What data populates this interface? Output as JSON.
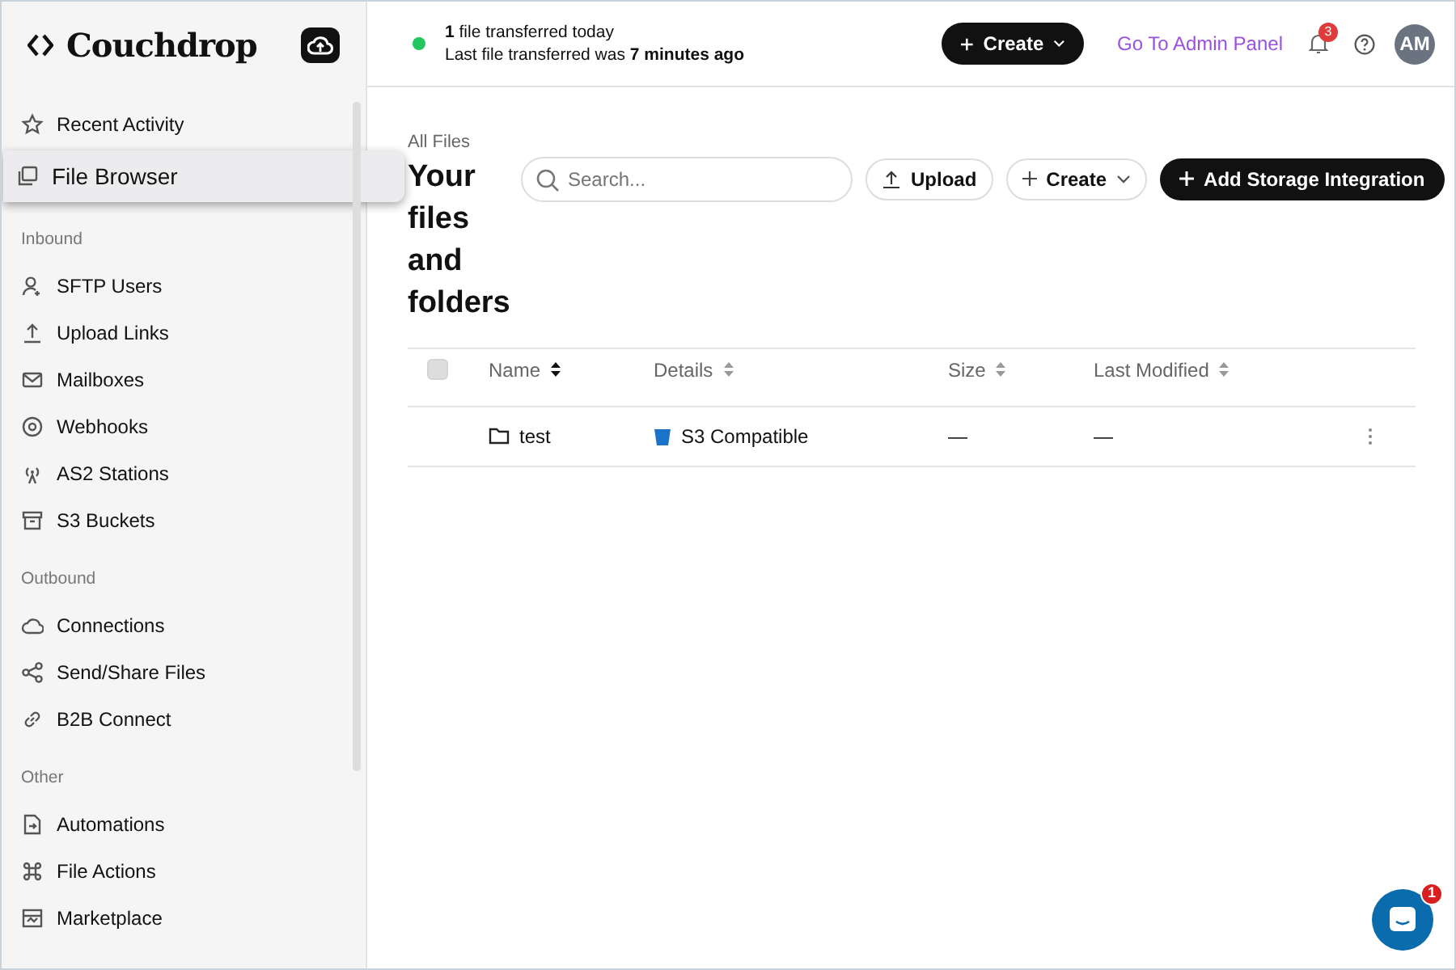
{
  "sidebar": {
    "logo": "Couchdrop",
    "sections": [
      {
        "items": [
          {
            "label": "Recent Activity",
            "selected": false
          },
          {
            "label": "File Browser",
            "selected": true
          }
        ]
      },
      {
        "heading": "Inbound",
        "items": [
          {
            "label": "SFTP Users",
            "selected": false
          },
          {
            "label": "Upload Links",
            "selected": false
          },
          {
            "label": "Mailboxes",
            "selected": false
          },
          {
            "label": "Webhooks",
            "selected": false
          },
          {
            "label": "AS2 Stations",
            "selected": false
          },
          {
            "label": "S3 Buckets",
            "selected": false
          }
        ]
      },
      {
        "heading": "Outbound",
        "items": [
          {
            "label": "Connections",
            "selected": false
          },
          {
            "label": "Send/Share Files",
            "selected": false
          },
          {
            "label": "B2B Connect",
            "selected": false
          }
        ]
      },
      {
        "heading": "Other",
        "items": [
          {
            "label": "Automations",
            "selected": false
          },
          {
            "label": "File Actions",
            "selected": false
          },
          {
            "label": "Marketplace",
            "selected": false
          }
        ]
      }
    ]
  },
  "topbar": {
    "status_line_1": "**1** file transferred today",
    "status_line_2": "Last file transferred was **7 minutes ago**",
    "create_button": "Create",
    "admin_link": "Go To Admin Panel",
    "notification_count": "3",
    "avatar": "AM"
  },
  "page": {
    "breadcrumb": "All Files",
    "title": "Your files and folders",
    "search": {
      "placeholder": "Search..."
    },
    "upload_button": "Upload",
    "create_button": "Create",
    "storage_button": "Add Storage Integration"
  },
  "table": {
    "select_all_checked": false,
    "columns": [
      {
        "label": "Name",
        "sorted": true
      },
      {
        "label": "Details",
        "sorted": false
      },
      {
        "label": "Size",
        "sorted": false
      },
      {
        "label": "Last Modified",
        "sorted": false
      }
    ],
    "rows": [
      {
        "name": "test",
        "details": "S3 Compatible",
        "size": "—",
        "modified": "—"
      }
    ]
  },
  "chat": {
    "badge": "1"
  }
}
